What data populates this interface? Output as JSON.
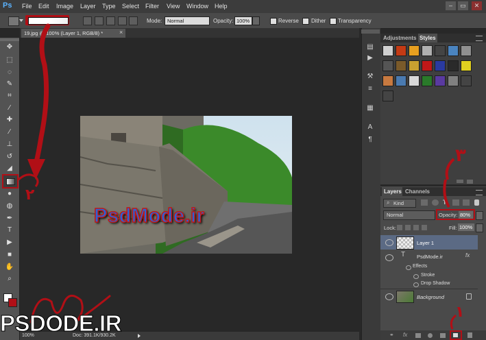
{
  "app": {
    "logo": "Ps"
  },
  "menus": [
    "File",
    "Edit",
    "Image",
    "Layer",
    "Type",
    "Select",
    "Filter",
    "View",
    "Window",
    "Help"
  ],
  "window_controls": [
    "–",
    "▭",
    "✕"
  ],
  "options_bar": {
    "mode_label": "Mode:",
    "mode_value": "Normal",
    "opacity_label": "Opacity:",
    "opacity_value": "100%",
    "reverse_label": "Reverse",
    "dither_label": "Dither",
    "transparency_label": "Transparency"
  },
  "document_tab": {
    "title": "19.jpg @ 100% (Layer 1, RGB/8) *",
    "close": "×"
  },
  "canvas_text": "PsdMode.ir",
  "status_bar": {
    "zoom": "100%",
    "doc_info": "Doc: 391.1K/930.2K"
  },
  "styles_panel": {
    "tabs": [
      "Adjustments",
      "Styles"
    ],
    "active_tab": "Styles"
  },
  "swatch_colors": [
    "#d0d0d0",
    "#c43a14",
    "#e8a020",
    "#b0b0b0",
    "#444444",
    "#4a84c0",
    "#909090",
    "#555555",
    "#7a5a2a",
    "#c8a030",
    "#c01818",
    "#2a3aa0",
    "#2a2a2a",
    "#e0d020",
    "#c87a40",
    "#4a7ab0",
    "#d8d8d8",
    "#2a7a2a",
    "#5a3aa0",
    "#808080",
    "#444444",
    "#444444"
  ],
  "layers_panel": {
    "tabs": [
      "Layers",
      "Channels"
    ],
    "active_tab": "Layers",
    "kind_label": "Kind",
    "blend_mode": "Normal",
    "opacity_label": "Opacity:",
    "opacity_value": "80%",
    "lock_label": "Lock:",
    "fill_label": "Fill:",
    "fill_value": "100%",
    "layers": [
      {
        "name": "Layer 1",
        "selected": true
      },
      {
        "name": "PsdMode.ir",
        "type_glyph": "T",
        "fx": "fx"
      },
      {
        "name": "Effects",
        "sub": true
      },
      {
        "name": "Stroke",
        "sub": true
      },
      {
        "name": "Drop Shadow",
        "sub": true
      },
      {
        "name": "Background",
        "locked": true
      }
    ]
  },
  "annotations": {
    "num_1": "١",
    "num_2": "٢",
    "num_3": "٣"
  },
  "watermark": {
    "text": "PSDODE.IR"
  },
  "colors": {
    "accent_red": "#b10f16",
    "ps_blue": "#5bb3ff"
  }
}
